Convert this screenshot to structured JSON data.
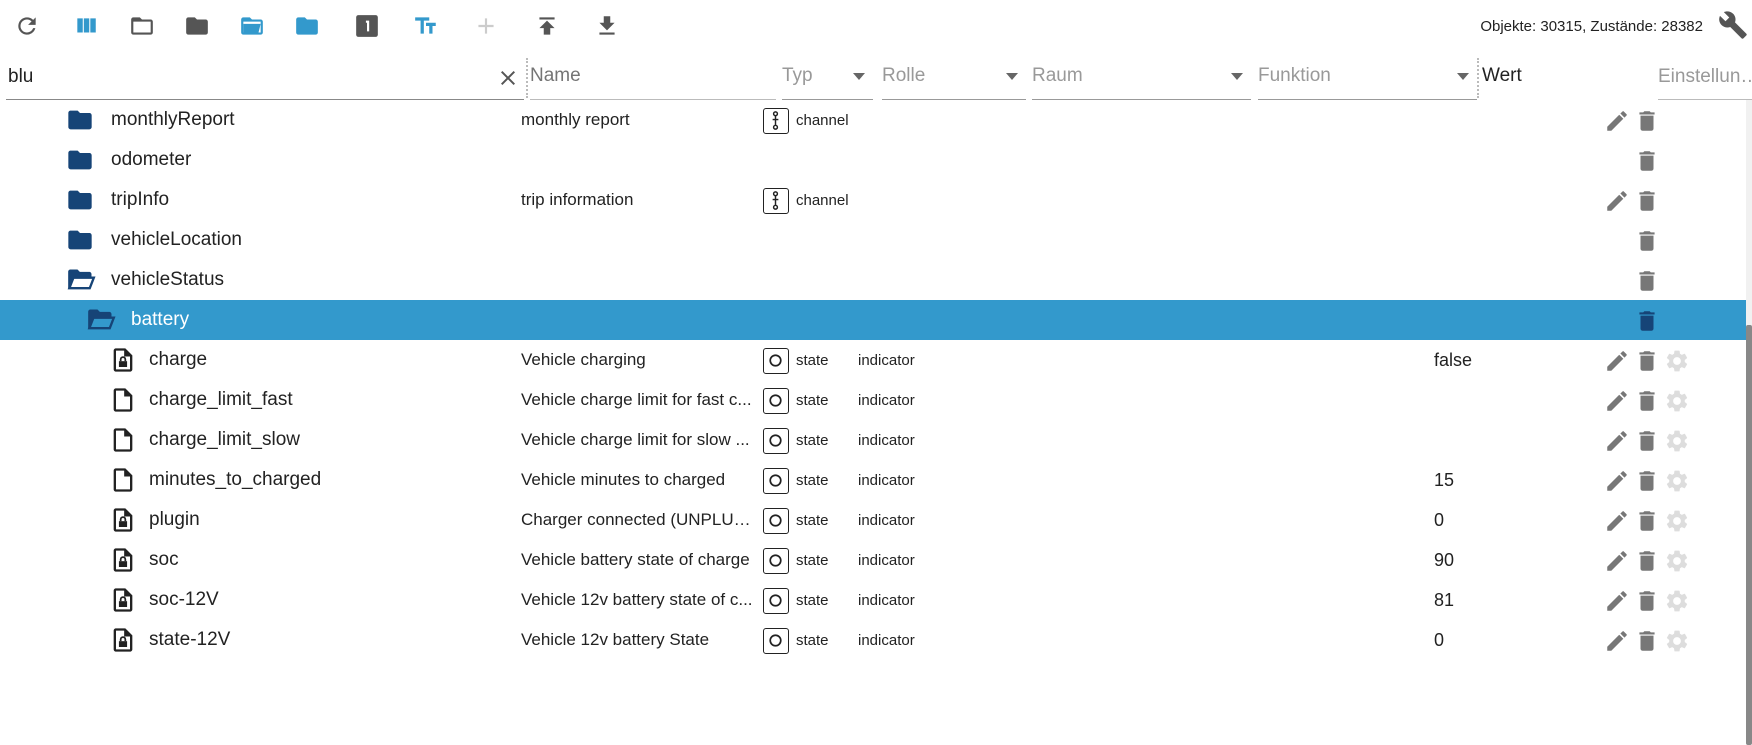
{
  "toolbar": {
    "buttons": [
      {
        "name": "refresh-icon",
        "color": "#555555"
      },
      {
        "name": "columns-icon",
        "color": "#3399cc"
      },
      {
        "name": "folder-open-icon",
        "color": "#555555"
      },
      {
        "name": "folder-icon",
        "color": "#555555"
      },
      {
        "name": "folder-open-blue-icon",
        "color": "#3399cc"
      },
      {
        "name": "folder-blue-icon",
        "color": "#3399cc"
      },
      {
        "name": "number-one-icon",
        "color": "#555555"
      },
      {
        "name": "text-size-icon",
        "color": "#3399cc"
      },
      {
        "name": "add-icon",
        "color": "#cccccc"
      },
      {
        "name": "upload-icon",
        "color": "#555555"
      },
      {
        "name": "download-icon",
        "color": "#555555"
      }
    ],
    "counts": "Objekte: 30315, Zustände: 28382"
  },
  "filters": {
    "search_value": "blu",
    "name_placeholder": "Name",
    "typ_label": "Typ",
    "rolle_label": "Rolle",
    "raum_label": "Raum",
    "funktion_label": "Funktion",
    "wert_label": "Wert",
    "einstellungen_label": "Einstellun…"
  },
  "rows": [
    {
      "icon": "folder",
      "name": "monthlyReport",
      "desc": "monthly report",
      "typ": "channel",
      "rolle": "",
      "wert": "",
      "edit": true,
      "gear": false
    },
    {
      "icon": "folder",
      "name": "odometer",
      "desc": "",
      "typ": "",
      "rolle": "",
      "wert": "",
      "edit": false,
      "gear": false
    },
    {
      "icon": "folder",
      "name": "tripInfo",
      "desc": "trip information",
      "typ": "channel",
      "rolle": "",
      "wert": "",
      "edit": true,
      "gear": false
    },
    {
      "icon": "folder",
      "name": "vehicleLocation",
      "desc": "",
      "typ": "",
      "rolle": "",
      "wert": "",
      "edit": false,
      "gear": false
    },
    {
      "icon": "folder-open",
      "name": "vehicleStatus",
      "desc": "",
      "typ": "",
      "rolle": "",
      "wert": "",
      "edit": false,
      "gear": false
    },
    {
      "icon": "folder-open",
      "name": "battery",
      "desc": "",
      "typ": "",
      "rolle": "",
      "wert": "",
      "edit": false,
      "gear": false,
      "selected": true
    },
    {
      "icon": "file-lock",
      "name": "charge",
      "desc": "Vehicle charging",
      "typ": "state",
      "rolle": "indicator",
      "wert": "false",
      "edit": true,
      "gear": true
    },
    {
      "icon": "file",
      "name": "charge_limit_fast",
      "desc": "Vehicle charge limit for fast c...",
      "typ": "state",
      "rolle": "indicator",
      "wert": "",
      "edit": true,
      "gear": true
    },
    {
      "icon": "file",
      "name": "charge_limit_slow",
      "desc": "Vehicle charge limit for slow ...",
      "typ": "state",
      "rolle": "indicator",
      "wert": "",
      "edit": true,
      "gear": true
    },
    {
      "icon": "file",
      "name": "minutes_to_charged",
      "desc": "Vehicle minutes to charged",
      "typ": "state",
      "rolle": "indicator",
      "wert": "15",
      "edit": true,
      "gear": true
    },
    {
      "icon": "file-lock",
      "name": "plugin",
      "desc": "Charger connected (UNPLUG...",
      "typ": "state",
      "rolle": "indicator",
      "wert": "0",
      "edit": true,
      "gear": true
    },
    {
      "icon": "file-lock",
      "name": "soc",
      "desc": "Vehicle battery state of charge",
      "typ": "state",
      "rolle": "indicator",
      "wert": "90",
      "edit": true,
      "gear": true
    },
    {
      "icon": "file-lock",
      "name": "soc-12V",
      "desc": "Vehicle 12v battery state of c...",
      "typ": "state",
      "rolle": "indicator",
      "wert": "81",
      "edit": true,
      "gear": true
    },
    {
      "icon": "file-lock",
      "name": "state-12V",
      "desc": "Vehicle 12v battery State",
      "typ": "state",
      "rolle": "indicator",
      "wert": "0",
      "edit": true,
      "gear": true
    }
  ],
  "colors": {
    "accent": "#3399cc",
    "folder": "#164477",
    "icon_gray": "#555555"
  }
}
